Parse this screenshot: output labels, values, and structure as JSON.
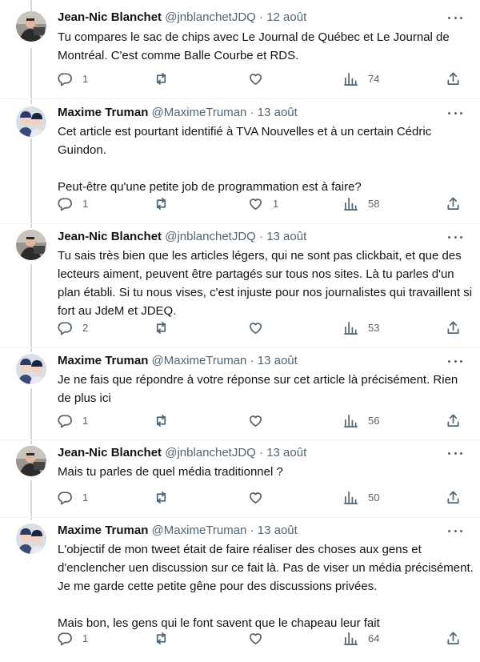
{
  "colors": {
    "text": "#0f1419",
    "secondary": "#536471",
    "thread_line": "#cfd9de",
    "divider": "#eff3f4"
  },
  "tweets": [
    {
      "author": "Jean-Nic Blanchet",
      "handle": "@jnblanchetJDQ",
      "separator": "·",
      "date": "12 août",
      "avatar": "jean-nic-avatar",
      "paragraphs": [
        "Tu compares le sac de chips avec Le Journal de Québec et Le Journal de Montréal. C'est comme Balle Courbe et RDS."
      ],
      "replies": "1",
      "retweets": "",
      "likes": "",
      "views": "74"
    },
    {
      "author": "Maxime Truman",
      "handle": "@MaximeTruman",
      "separator": "·",
      "date": "13 août",
      "avatar": "maxime-avatar",
      "paragraphs": [
        "Cet article est pourtant identifié à TVA Nouvelles et à un certain Cédric Guindon.",
        "Peut-être qu'une petite job de programmation est à faire?"
      ],
      "replies": "1",
      "retweets": "",
      "likes": "1",
      "views": "58"
    },
    {
      "author": "Jean-Nic Blanchet",
      "handle": "@jnblanchetJDQ",
      "separator": "·",
      "date": "13 août",
      "avatar": "jean-nic-avatar",
      "paragraphs": [
        "Tu sais très bien que les articles légers, qui ne sont pas clickbait, et que des lecteurs aiment, peuvent être partagés sur tous nos sites. Là tu parles d'un plan établi. Si tu nous vises, c'est injuste pour nos journalistes qui travaillent si fort au JdeM et JDEQ."
      ],
      "replies": "2",
      "retweets": "",
      "likes": "",
      "views": "53"
    },
    {
      "author": "Maxime Truman",
      "handle": "@MaximeTruman",
      "separator": "·",
      "date": "13 août",
      "avatar": "maxime-avatar",
      "paragraphs": [
        "Je ne fais que répondre à votre réponse sur cet article là précisément. Rien de plus ici"
      ],
      "replies": "1",
      "retweets": "",
      "likes": "",
      "views": "56"
    },
    {
      "author": "Jean-Nic Blanchet",
      "handle": "@jnblanchetJDQ",
      "separator": "·",
      "date": "13 août",
      "avatar": "jean-nic-avatar",
      "paragraphs": [
        "Mais tu parles de quel média traditionnel ?"
      ],
      "replies": "1",
      "retweets": "",
      "likes": "",
      "views": "50"
    },
    {
      "author": "Maxime Truman",
      "handle": "@MaximeTruman",
      "separator": "·",
      "date": "13 août",
      "avatar": "maxime-avatar",
      "paragraphs": [
        "L'objectif de mon tweet était de faire réaliser des choses aux gens et d'enclencher uen discussion sur ce fait là. Pas de viser un média précisément. Je me garde cette petite gêne pour des discussions privées.",
        "Mais bon, les gens qui le font savent que le chapeau leur fait"
      ],
      "replies": "1",
      "retweets": "",
      "likes": "",
      "views": "64"
    }
  ]
}
